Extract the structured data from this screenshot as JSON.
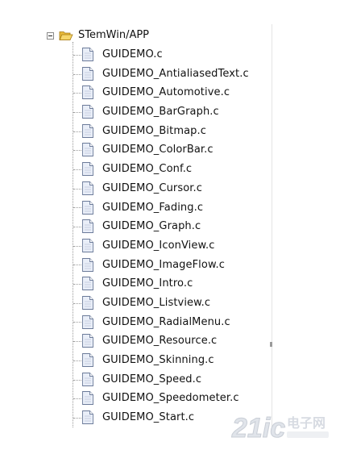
{
  "tree": {
    "root": {
      "label": "STemWin/APP",
      "expanded": true
    },
    "items": [
      {
        "label": "GUIDEMO.c"
      },
      {
        "label": "GUIDEMO_AntialiasedText.c"
      },
      {
        "label": "GUIDEMO_Automotive.c"
      },
      {
        "label": "GUIDEMO_BarGraph.c"
      },
      {
        "label": "GUIDEMO_Bitmap.c"
      },
      {
        "label": "GUIDEMO_ColorBar.c"
      },
      {
        "label": "GUIDEMO_Conf.c"
      },
      {
        "label": "GUIDEMO_Cursor.c"
      },
      {
        "label": "GUIDEMO_Fading.c"
      },
      {
        "label": "GUIDEMO_Graph.c"
      },
      {
        "label": "GUIDEMO_IconView.c"
      },
      {
        "label": "GUIDEMO_ImageFlow.c"
      },
      {
        "label": "GUIDEMO_Intro.c"
      },
      {
        "label": "GUIDEMO_Listview.c"
      },
      {
        "label": "GUIDEMO_RadialMenu.c"
      },
      {
        "label": "GUIDEMO_Resource.c"
      },
      {
        "label": "GUIDEMO_Skinning.c"
      },
      {
        "label": "GUIDEMO_Speed.c"
      },
      {
        "label": "GUIDEMO_Speedometer.c"
      },
      {
        "label": "GUIDEMO_Start.c"
      }
    ]
  },
  "icons": {
    "expander": "collapse-minus-icon",
    "folder": "open-folder-icon",
    "file": "source-file-icon"
  },
  "colors": {
    "folder": "#f0c64a",
    "file_fill": "#e9eef8",
    "file_stroke": "#6b7a99",
    "text": "#111111",
    "tree_line": "#9a9a9a"
  },
  "watermark": {
    "brand": "21ic",
    "text": "电子网"
  }
}
